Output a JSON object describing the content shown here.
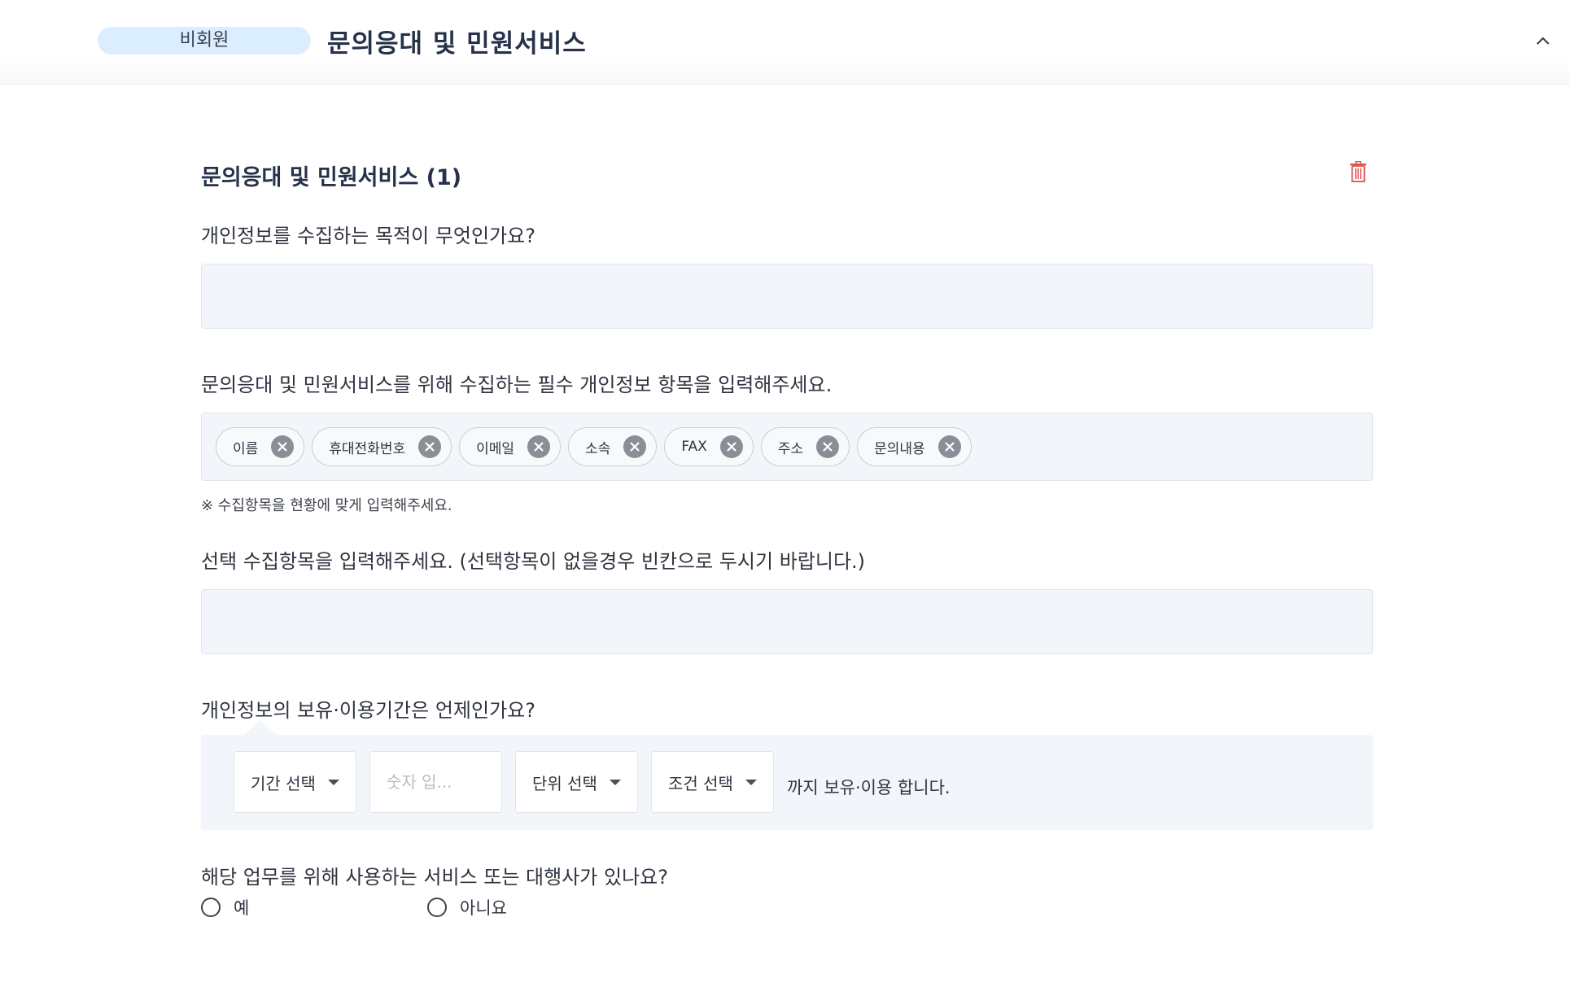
{
  "header": {
    "badge": "비회원",
    "title": "문의응대 및 민원서비스"
  },
  "section": {
    "title": "문의응대 및 민원서비스 (1)"
  },
  "q1": {
    "label": "개인정보를 수집하는 목적이 무엇인가요?",
    "value": ""
  },
  "q2": {
    "label": "문의응대 및 민원서비스를 위해 수집하는 필수 개인정보 항목을 입력해주세요.",
    "chips": [
      "이름",
      "휴대전화번호",
      "이메일",
      "소속",
      "FAX",
      "주소",
      "문의내용"
    ],
    "hint": "※ 수집항목을 현황에 맞게 입력해주세요."
  },
  "q3": {
    "label": "선택 수집항목을 입력해주세요. (선택항목이 없을경우 빈칸으로 두시기 바랍니다.)",
    "value": ""
  },
  "q4": {
    "label": "개인정보의 보유·이용기간은 언제인가요?",
    "period_select": "기간 선택",
    "number_placeholder": "숫자 입...",
    "unit_select": "단위 선택",
    "condition_select": "조건 선택",
    "suffix": "까지 보유·이용 합니다."
  },
  "q5": {
    "label": "해당 업무를 위해 사용하는 서비스 또는 대행사가 있나요?",
    "options": [
      "예",
      "아니요"
    ]
  },
  "colors": {
    "badge_bg": "#dbeeff",
    "title": "#26314a",
    "field_bg": "#f2f5f9",
    "trash": "#d9534f"
  }
}
